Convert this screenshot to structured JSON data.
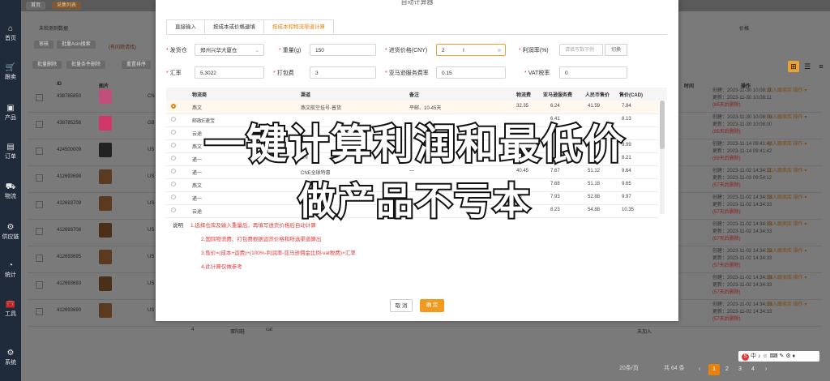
{
  "sidebar": {
    "items": [
      {
        "icon": "home-icon",
        "glyph": "⌂",
        "label": "首页"
      },
      {
        "icon": "cart-icon",
        "glyph": "🛒",
        "label": "跟卖"
      },
      {
        "icon": "box-icon",
        "glyph": "▣",
        "label": "产品"
      },
      {
        "icon": "order-icon",
        "glyph": "▤",
        "label": "订单"
      },
      {
        "icon": "truck-icon",
        "glyph": "⛟",
        "label": "物流"
      },
      {
        "icon": "supply-icon",
        "glyph": "⚙",
        "label": "供应链"
      },
      {
        "icon": "stats-icon",
        "glyph": "◔",
        "label": "统计"
      },
      {
        "icon": "tools-icon",
        "glyph": "🧰",
        "label": "工具"
      },
      {
        "icon": "settings-icon",
        "glyph": "⚙",
        "label": "系统"
      }
    ]
  },
  "topbar": {
    "home_tab": "首页",
    "active_tab": "采集列表"
  },
  "background": {
    "filter_label": "未检测到数据",
    "buttons": [
      "批量删除",
      "批量条件删除",
      "重置排序"
    ],
    "toolbar_buttons": [
      "审核",
      "批量Asin搜索"
    ],
    "hint": "(有问题请找)",
    "columns": {
      "id": "ID",
      "image": "图片",
      "time": "时间",
      "ops": "操作",
      "price": "价格"
    },
    "rows": [
      {
        "id": "438785850",
        "cc": "CN",
        "created": "创建：2023-11-30 10:08:11",
        "updated": "更新：2023-11-30 10:08:11",
        "note": "(85天后删除)",
        "ops": "加入跟卖库  操作 ▾"
      },
      {
        "id": "438785256",
        "cc": "GB",
        "created": "创建：2023-11-30 10:08:00",
        "updated": "更新：2023-11-30 10:08:00",
        "note": "(85天后删除)",
        "ops": "加入跟卖库  操作 ▾"
      },
      {
        "id": "424500009",
        "cc": "US",
        "created": "创建：2023-11-14 09:41:42",
        "updated": "更新：2023-11-14 09:41:42",
        "note": "(69天后删除)",
        "ops": "加入跟卖库  操作 ▾"
      },
      {
        "id": "412693698",
        "cc": "US",
        "created": "创建：2023-11-02 14:34:31",
        "updated": "更新：2023-11-03 09:54:12",
        "note": "(57天后删除)",
        "ops": "加入跟卖库  操作 ▾"
      },
      {
        "id": "412693709",
        "cc": "US",
        "created": "创建：2023-11-02 14:34:33",
        "updated": "更新：2023-11-02 14:34:33",
        "note": "(57天后删除)",
        "ops": "加入跟卖库  操作 ▾"
      },
      {
        "id": "412693708",
        "cc": "US",
        "created": "创建：2023-11-02 14:34:33",
        "updated": "更新：2023-11-02 14:34:33",
        "note": "(57天后删除)",
        "ops": "加入跟卖库  操作 ▾"
      },
      {
        "id": "412693695",
        "cc": "US",
        "created": "创建：2023-11-02 14:34:33",
        "updated": "更新：2023-11-02 14:34:33",
        "note": "(57天后删除)",
        "ops": "加入跟卖库  操作 ▾"
      },
      {
        "id": "412693693",
        "cc": "US",
        "created": "创建：2023-11-02 14:34:33",
        "updated": "更新：2023-11-02 14:34:33",
        "note": "(57天后删除)",
        "ops": "加入跟卖库  操作 ▾"
      },
      {
        "id": "412693690",
        "cc": "US",
        "created": "创建：2023-11-02 14:34:33",
        "updated": "更新：2023-11-02 14:34:33",
        "note": "(57天后删除)",
        "ops": "加入跟卖库  操作 ▾"
      }
    ],
    "bottom_row": {
      "num": "4",
      "name": "蛋阳鞋",
      "tag": "cat",
      "status": "未加入"
    },
    "pager": {
      "page_size": "20条/页",
      "total": "共 64 条",
      "pages": [
        "1",
        "2",
        "3",
        "4"
      ]
    }
  },
  "modal": {
    "title": "自动计算器",
    "tabs": [
      "直接输入",
      "按成本或价格速填",
      "按成本和物流渠道计算"
    ],
    "active_tab": 2,
    "fields": {
      "warehouse": {
        "label": "发货仓",
        "value": "郑州兴华大厦仓"
      },
      "weight": {
        "label": "重量(g)",
        "value": "150"
      },
      "price": {
        "label": "进货价格(CNY)",
        "value": "2"
      },
      "profit": {
        "label": "利润率(%)",
        "placeholder": "请填写数字例",
        "toggle": "切换"
      },
      "rate": {
        "label": "汇率",
        "value": "5.3022"
      },
      "pack": {
        "label": "打包费",
        "value": "3"
      },
      "fee_rate": {
        "label": "亚马逊服务费率",
        "value": "0.15"
      },
      "vat": {
        "label": "VAT税率",
        "value": "0"
      }
    },
    "table": {
      "headers": [
        "物流商",
        "渠道",
        "备注",
        "物流费",
        "亚马逊服务费",
        "人民币售价",
        "售价(CAD)"
      ],
      "rows": [
        {
          "vendor": "燕文",
          "channel": "燕文航空挂号-普货",
          "note": "平邮、10-45天",
          "fee": "32.35",
          "amz": "6.24",
          "cny": "41.59",
          "cad": "7.84"
        },
        {
          "vendor": "邮政E速宝",
          "channel": "",
          "note": "",
          "fee": "",
          "amz": "6.41",
          "cny": "",
          "cad": "8.13"
        },
        {
          "vendor": "云途",
          "channel": "",
          "note": "",
          "fee": "",
          "amz": "",
          "cny": "",
          "cad": ""
        },
        {
          "vendor": "燕文",
          "channel": "",
          "note": "",
          "fee": "",
          "amz": "",
          "cny": "",
          "cad": "9.99"
        },
        {
          "vendor": "递一",
          "channel": "CN",
          "note": "",
          "fee": "",
          "amz": "",
          "cny": "",
          "cad": "8.21"
        },
        {
          "vendor": "递一",
          "channel": "CNE全球特惠",
          "note": "—",
          "fee": "40.45",
          "amz": "7.67",
          "cny": "51.12",
          "cad": "9.64"
        },
        {
          "vendor": "燕文",
          "channel": "",
          "note": "",
          "fee": "",
          "amz": "7.68",
          "cny": "51.18",
          "cad": "9.65"
        },
        {
          "vendor": "递一",
          "channel": "",
          "note": "",
          "fee": "95",
          "amz": "7.93",
          "cny": "52.88",
          "cad": "9.97"
        },
        {
          "vendor": "云途",
          "channel": "",
          "note": "",
          "fee": "",
          "amz": "8.23",
          "cny": "54.88",
          "cad": "10.35"
        }
      ]
    },
    "notes_title": "说明",
    "notes": [
      "1.选择仓库及输入重量后，再填写进货价格后自动计算",
      "2.国际物流费、打包费根据运货价格和所选渠道算出",
      "3.售价=(成本+运费)÷(100%-利润率-亚马逊佣金比例-vat税费)×汇率",
      "4.此计算仅做参考"
    ],
    "cancel": "取 消",
    "ok": "确 定"
  },
  "overlay": {
    "line1": "一键计算利润和最低价",
    "line2": "做产品不亏本"
  },
  "ime": {
    "label": "中 ♪ ☺ ⌨ ✎ ⚙ ♦"
  }
}
